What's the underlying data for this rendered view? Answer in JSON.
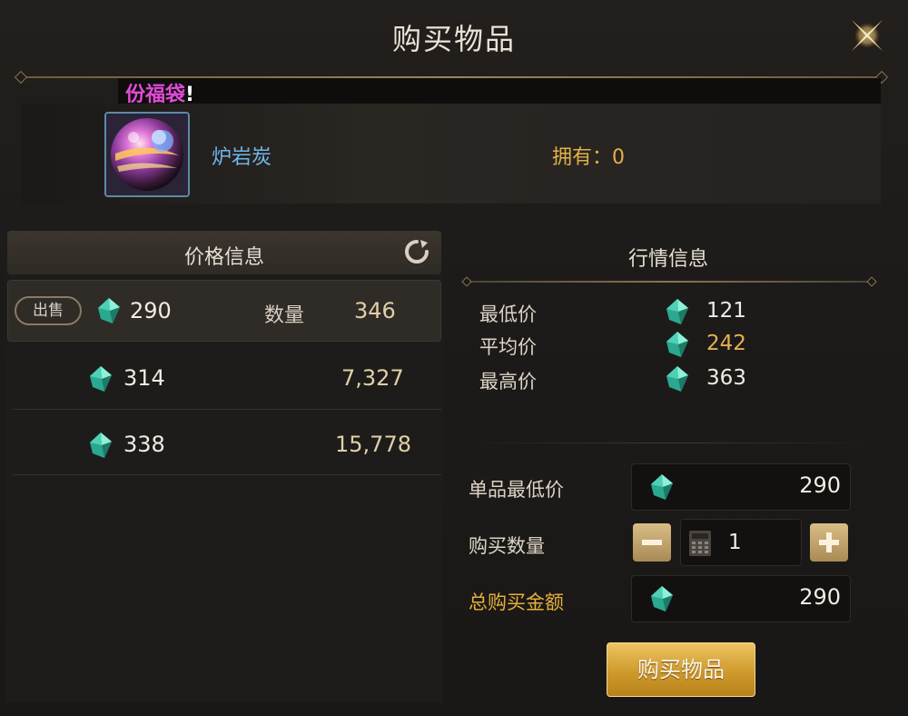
{
  "header": {
    "title": "购买物品"
  },
  "marquee": {
    "text": "份福袋",
    "excl": "!"
  },
  "item": {
    "name": "炉岩炭",
    "owned": "拥有：0"
  },
  "price_panel": {
    "title": "价格信息",
    "selected_row": {
      "sell_label": "出售",
      "price": "290",
      "qty_label": "数量",
      "qty": "346"
    },
    "rows": [
      {
        "price": "314",
        "qty": "7,327"
      },
      {
        "price": "338",
        "qty": "15,778"
      }
    ]
  },
  "market_panel": {
    "title": "行情信息",
    "lowest_label": "最低价",
    "lowest": "121",
    "average_label": "平均价",
    "average": "242",
    "highest_label": "最高价",
    "highest": "363"
  },
  "purchase": {
    "unit_min_label": "单品最低价",
    "unit_min": "290",
    "quantity_label": "购买数量",
    "quantity": "1",
    "total_label": "总购买金额",
    "total": "290",
    "buy_button": "购买物品"
  },
  "colors": {
    "gold": "#e6b050",
    "gem": "#3fd0b8",
    "name_blue": "#6fb6e8",
    "marquee_pink": "#e24ad8"
  },
  "icons": [
    "close-icon",
    "refresh-icon",
    "gem-icon",
    "calculator-icon",
    "minus-icon",
    "plus-icon"
  ]
}
